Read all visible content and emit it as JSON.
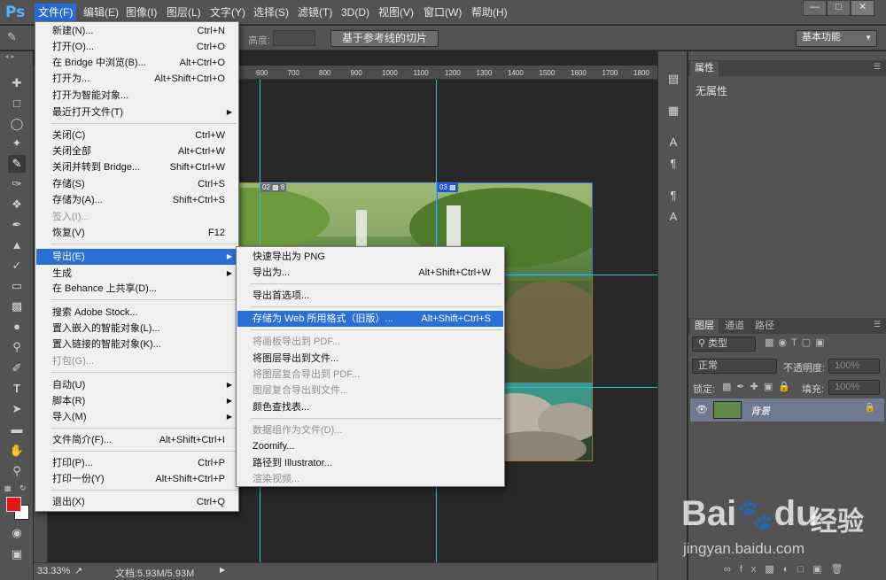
{
  "app": {
    "logo": "Ps"
  },
  "menubar": {
    "items": [
      {
        "label": "文件(F)"
      },
      {
        "label": "编辑(E)"
      },
      {
        "label": "图像(I)"
      },
      {
        "label": "图层(L)"
      },
      {
        "label": "文字(Y)"
      },
      {
        "label": "选择(S)"
      },
      {
        "label": "滤镜(T)"
      },
      {
        "label": "3D(D)"
      },
      {
        "label": "视图(V)"
      },
      {
        "label": "窗口(W)"
      },
      {
        "label": "帮助(H)"
      }
    ]
  },
  "options": {
    "height_label": "高度:",
    "slice_button": "基于参考线的切片",
    "workspace": "基本功能"
  },
  "ruler": {
    "labels": [
      "600",
      "700",
      "800",
      "900",
      "1000",
      "1100",
      "1200",
      "1300",
      "1400",
      "1500",
      "1600",
      "1700",
      "1800",
      "1900",
      "2000"
    ]
  },
  "slices": {
    "s2": "02",
    "s2_extra": "8",
    "s3": "03"
  },
  "status": {
    "zoom": "33.33%",
    "doc": "文档:5.93M/5.93M"
  },
  "properties": {
    "tab": "属性",
    "empty": "无属性"
  },
  "layers": {
    "tabs": [
      "图层",
      "通道",
      "路径"
    ],
    "kind": "类型",
    "blend": "正常",
    "opacity_label": "不透明度:",
    "opacity_value": "100%",
    "lock_label": "锁定:",
    "fill_label": "填充:",
    "fill_value": "100%",
    "layer_name": "背景"
  },
  "file_menu": {
    "items": [
      {
        "label": "新建(N)...",
        "shortcut": "Ctrl+N"
      },
      {
        "label": "打开(O)...",
        "shortcut": "Ctrl+O"
      },
      {
        "label": "在 Bridge 中浏览(B)...",
        "shortcut": "Alt+Ctrl+O"
      },
      {
        "label": "打开为...",
        "shortcut": "Alt+Shift+Ctrl+O"
      },
      {
        "label": "打开为智能对象..."
      },
      {
        "label": "最近打开文件(T)",
        "submenu": true
      },
      {
        "label": "关闭(C)",
        "shortcut": "Ctrl+W"
      },
      {
        "label": "关闭全部",
        "shortcut": "Alt+Ctrl+W"
      },
      {
        "label": "关闭并转到 Bridge...",
        "shortcut": "Shift+Ctrl+W"
      },
      {
        "label": "存储(S)",
        "shortcut": "Ctrl+S"
      },
      {
        "label": "存储为(A)...",
        "shortcut": "Shift+Ctrl+S"
      },
      {
        "label": "签入(I)...",
        "disabled": true
      },
      {
        "label": "恢复(V)",
        "shortcut": "F12"
      },
      {
        "label": "导出(E)",
        "submenu": true,
        "highlighted": true
      },
      {
        "label": "生成",
        "submenu": true
      },
      {
        "label": "在 Behance 上共享(D)..."
      },
      {
        "label": "搜索 Adobe Stock..."
      },
      {
        "label": "置入嵌入的智能对象(L)..."
      },
      {
        "label": "置入链接的智能对象(K)..."
      },
      {
        "label": "打包(G)...",
        "disabled": true
      },
      {
        "label": "自动(U)",
        "submenu": true
      },
      {
        "label": "脚本(R)",
        "submenu": true
      },
      {
        "label": "导入(M)",
        "submenu": true
      },
      {
        "label": "文件简介(F)...",
        "shortcut": "Alt+Shift+Ctrl+I"
      },
      {
        "label": "打印(P)...",
        "shortcut": "Ctrl+P"
      },
      {
        "label": "打印一份(Y)",
        "shortcut": "Alt+Shift+Ctrl+P"
      },
      {
        "label": "退出(X)",
        "shortcut": "Ctrl+Q"
      }
    ]
  },
  "export_menu": {
    "items": [
      {
        "label": "快速导出为 PNG"
      },
      {
        "label": "导出为...",
        "shortcut": "Alt+Shift+Ctrl+W"
      },
      {
        "label": "导出首选项..."
      },
      {
        "label": "存储为 Web 所用格式（旧版）...",
        "shortcut": "Alt+Shift+Ctrl+S",
        "highlighted": true
      },
      {
        "label": "将画板导出到 PDF...",
        "disabled": true
      },
      {
        "label": "将图层导出到文件..."
      },
      {
        "label": "将图层复合导出到 PDF...",
        "disabled": true
      },
      {
        "label": "图层复合导出到文件...",
        "disabled": true
      },
      {
        "label": "颜色查找表..."
      },
      {
        "label": "数据组作为文件(D)...",
        "disabled": true
      },
      {
        "label": "Zoomify..."
      },
      {
        "label": "路径到 Illustrator..."
      },
      {
        "label": "渲染视频...",
        "disabled": true
      }
    ]
  },
  "watermark": {
    "brand": "Bai",
    "brand2": "du",
    "cn": "经验",
    "url": "jingyan.baidu.com"
  }
}
